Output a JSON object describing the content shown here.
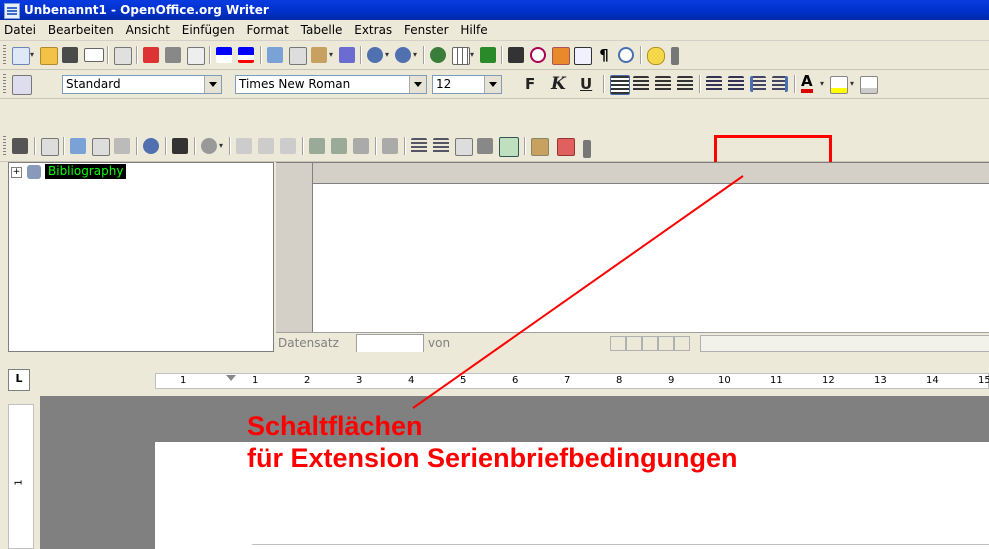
{
  "window": {
    "title": "Unbenannt1 - OpenOffice.org Writer"
  },
  "menu": [
    "Datei",
    "Bearbeiten",
    "Ansicht",
    "Einfügen",
    "Format",
    "Tabelle",
    "Extras",
    "Fenster",
    "Hilfe"
  ],
  "format_toolbar": {
    "style": "Standard",
    "font": "Times New Roman",
    "size": "12",
    "bold": "F",
    "italic": "K",
    "underline": "U",
    "font_color_letter": "A"
  },
  "datasource": {
    "tree_root": "Bibliography",
    "record_label": "Datensatz",
    "record_value": "",
    "of_label": "von"
  },
  "ruler": {
    "numbers": [
      "1",
      "1",
      "2",
      "3",
      "4",
      "5",
      "6",
      "7",
      "8",
      "9",
      "10",
      "11",
      "12",
      "13",
      "14",
      "15"
    ],
    "vertical_number": "1"
  },
  "annotation": {
    "line1": "Schaltflächen",
    "line2": "für Extension Serienbriefbedingungen",
    "color": "#ff0000"
  },
  "icons": [
    "new-icon",
    "open-icon",
    "save-icon",
    "email-icon",
    "edit-icon",
    "pdf-icon",
    "print-icon",
    "preview-icon",
    "spellcheck-icon",
    "autospell-icon",
    "cut-icon",
    "copy-icon",
    "paste-icon",
    "clone-icon",
    "undo-icon",
    "redo-icon",
    "navigator-icon",
    "table-icon",
    "draw-icon",
    "find-icon",
    "gallery-icon",
    "datasource-icon",
    "nonprint-icon",
    "zoom-icon",
    "help-icon",
    "serialletter-condition-icon",
    "serialletter-delete-icon"
  ]
}
